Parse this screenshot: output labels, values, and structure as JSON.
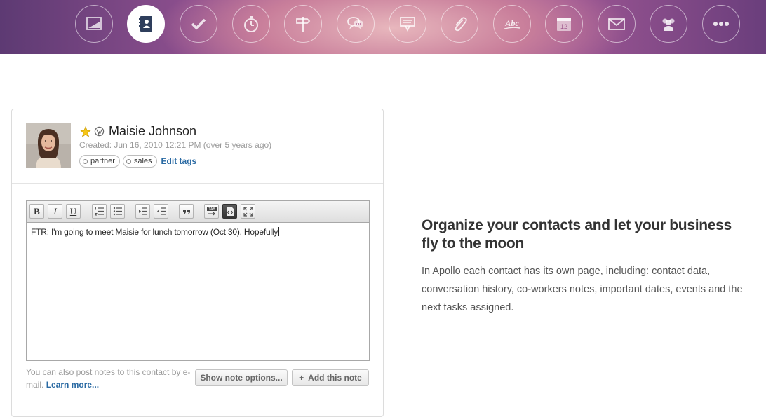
{
  "nav": {
    "icons": [
      {
        "name": "dashboard-icon",
        "active": false
      },
      {
        "name": "contacts-book-icon",
        "active": true
      },
      {
        "name": "checkmark-icon",
        "active": false
      },
      {
        "name": "stopwatch-icon",
        "active": false
      },
      {
        "name": "signpost-icon",
        "active": false
      },
      {
        "name": "chat-bubbles-icon",
        "active": false
      },
      {
        "name": "inbox-icon",
        "active": false
      },
      {
        "name": "paperclip-icon",
        "active": false
      },
      {
        "name": "spellcheck-icon",
        "active": false
      },
      {
        "name": "calendar-icon",
        "active": false
      },
      {
        "name": "envelope-icon",
        "active": false
      },
      {
        "name": "people-icon",
        "active": false
      },
      {
        "name": "more-dots-icon",
        "active": false
      }
    ],
    "abc_label": "Abc",
    "calendar_day": "12"
  },
  "contact": {
    "name": "Maisie Johnson",
    "created": "Created: Jun 16, 2010 12:21 PM (over 5 years ago)",
    "tags": [
      "partner",
      "sales"
    ],
    "edit_tags": "Edit tags"
  },
  "editor": {
    "toolbar": {
      "bold": "B",
      "italic": "I",
      "underline": "U",
      "tab_label": "TAB"
    },
    "content": "FTR: I'm going to meet Maisie for lunch tomorrow (Oct 30). Hopefully"
  },
  "footer": {
    "note": "You can also post notes to this contact by e-mail.",
    "learn_more": "Learn more...",
    "show_options": "Show note options...",
    "add_note": "Add this note",
    "add_icon": "+"
  },
  "promo": {
    "title": "Organize your contacts and let your business fly to the moon",
    "text": "In Apollo each contact has its own page, including: contact data, conversation history, co-workers notes, important dates, events and the next tasks assigned."
  },
  "colors": {
    "link": "#2a6aa3",
    "star": "#f5c518"
  }
}
